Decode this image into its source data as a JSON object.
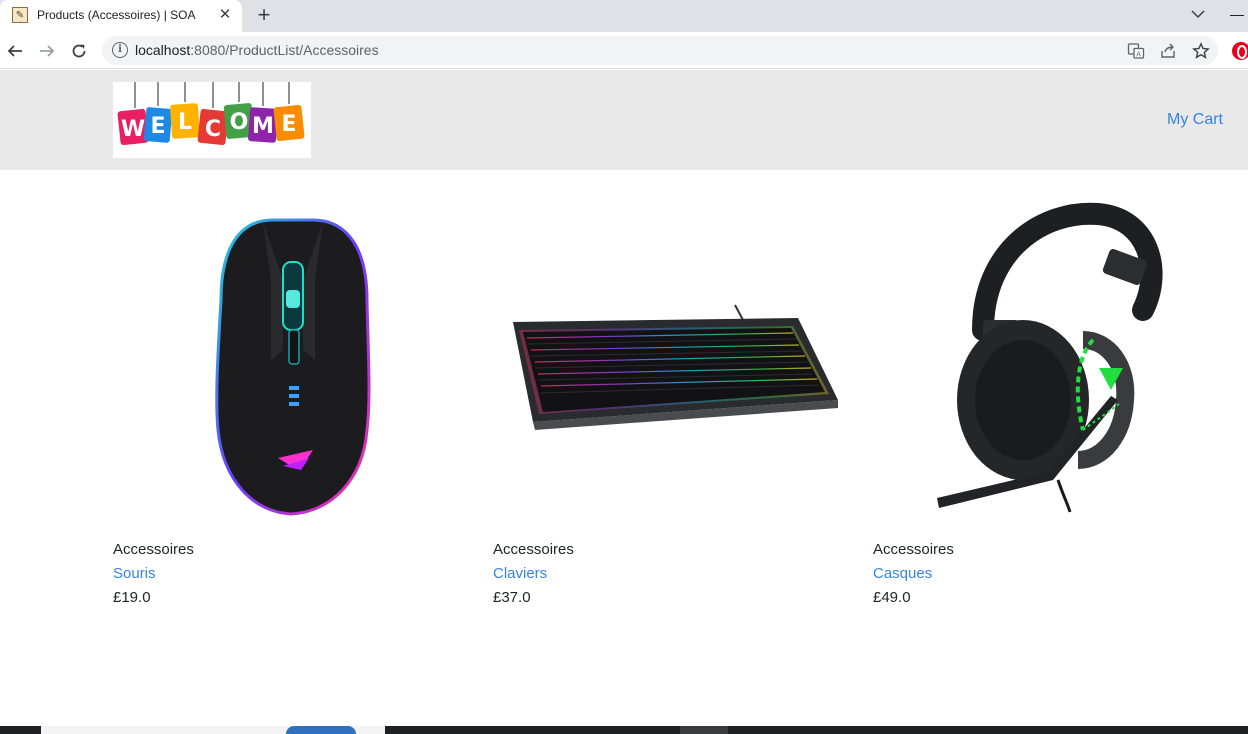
{
  "browser": {
    "tab_title": "Products (Accessoires) | SOA",
    "url_host": "localhost",
    "url_rest": ":8080/ProductList/Accessoires"
  },
  "header": {
    "logo_text": "WELCOME",
    "cart_label": "My Cart"
  },
  "products": [
    {
      "category": "Accessoires",
      "name": "Souris",
      "price": "£19.0",
      "image": "gaming-mouse"
    },
    {
      "category": "Accessoires",
      "name": "Claviers",
      "price": "£37.0",
      "image": "rgb-keyboard"
    },
    {
      "category": "Accessoires",
      "name": "Casques",
      "price": "£49.0",
      "image": "gaming-headset"
    }
  ],
  "colors": {
    "link": "#3584e4",
    "header_bg": "#e9e9e9",
    "text": "#212529"
  }
}
